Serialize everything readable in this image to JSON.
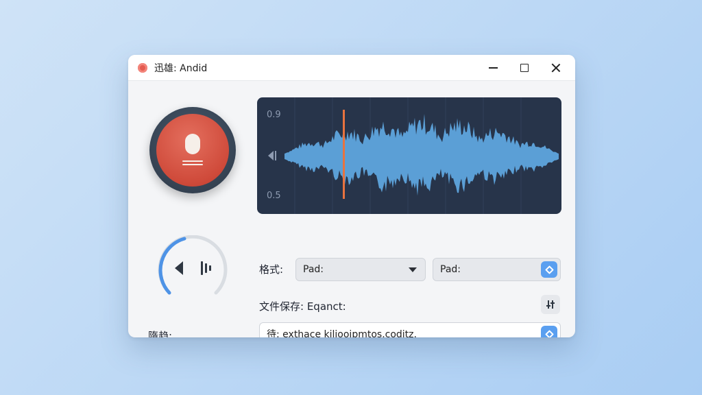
{
  "window": {
    "title": "迅雄: Andid"
  },
  "waveform": {
    "top_label": "0.9",
    "bottom_label": "0.5",
    "playhead_color": "#e8733f",
    "wave_color": "#5b9fd6"
  },
  "format": {
    "label": "格式:",
    "primary_value": "Pad:",
    "secondary_value": "Pad:"
  },
  "save": {
    "label": "文件保存: Eqanct:"
  },
  "path": {
    "label": "隋趋:",
    "value": "待: exthace kiliooipmtos.coditz."
  },
  "icons": {
    "app": "record-dot-icon",
    "record": "microphone-icon",
    "volume": "speaker-icon",
    "adjust": "sliders-icon"
  },
  "colors": {
    "record_button": "#d24d3d",
    "accent_blue": "#5a9ff0",
    "panel_bg": "#27344a"
  }
}
